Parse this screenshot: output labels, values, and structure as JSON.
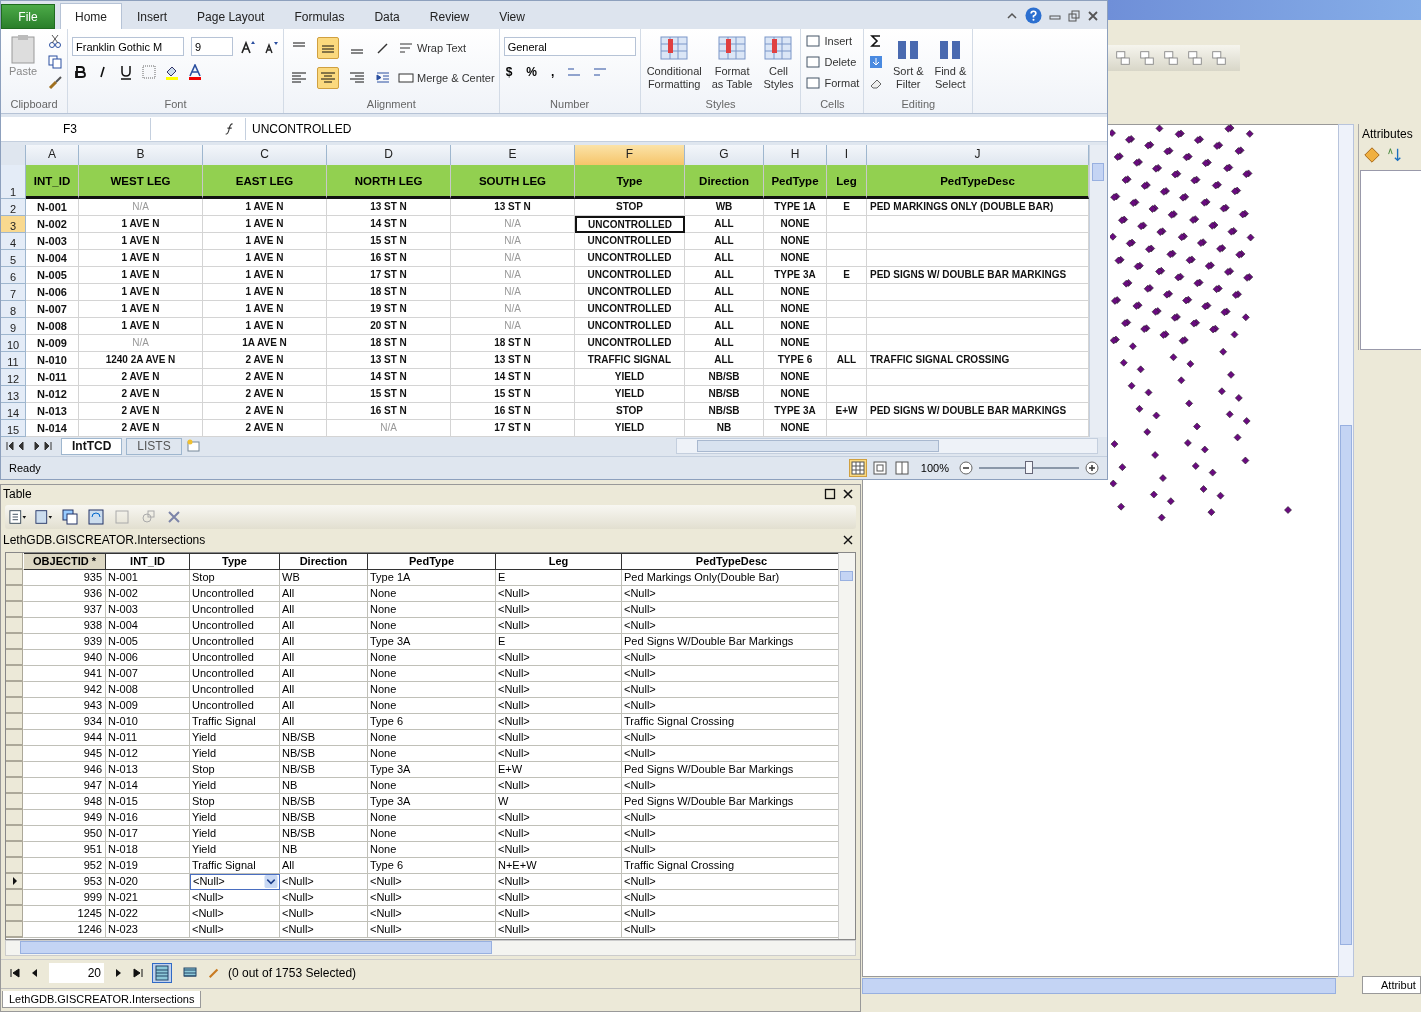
{
  "excel": {
    "file_tab": "File",
    "tabs": [
      {
        "label": "Home",
        "selected": true
      },
      {
        "label": "Insert",
        "selected": false
      },
      {
        "label": "Page Layout",
        "selected": false
      },
      {
        "label": "Formulas",
        "selected": false
      },
      {
        "label": "Data",
        "selected": false
      },
      {
        "label": "Review",
        "selected": false
      },
      {
        "label": "View",
        "selected": false
      }
    ],
    "ribbon": [
      {
        "kind": "clipboard",
        "label": "Clipboard",
        "paste": "Paste"
      },
      {
        "kind": "font",
        "label": "Font",
        "font_name": "Franklin Gothic M",
        "font_size": "9"
      },
      {
        "kind": "alignment",
        "label": "Alignment",
        "vertical_align": [
          {
            "selected": false
          },
          {
            "selected": true
          },
          {
            "selected": false
          }
        ],
        "horizontal_align": [
          {
            "selected": false
          },
          {
            "selected": true
          },
          {
            "selected": false
          }
        ],
        "wrap_text": "Wrap Text",
        "merge": "Merge & Center"
      },
      {
        "kind": "number",
        "label": "Number",
        "format": "General",
        "symbols": [
          "$",
          "%",
          ","
        ]
      },
      {
        "kind": "styles",
        "label": "Styles",
        "buttons": [
          {
            "lines": [
              "Conditional",
              "Formatting"
            ]
          },
          {
            "lines": [
              "Format",
              "as Table"
            ]
          },
          {
            "lines": [
              "Cell",
              "Styles"
            ]
          }
        ]
      },
      {
        "kind": "cells",
        "label": "Cells",
        "buttons": [
          "Insert",
          "Delete",
          "Format"
        ]
      },
      {
        "kind": "editing",
        "label": "Editing",
        "buttons": [
          {
            "lines": [
              "Sort &",
              "Filter"
            ]
          },
          {
            "lines": [
              "Find &",
              "Select"
            ]
          }
        ]
      }
    ],
    "name_box": "F3",
    "formula": "UNCONTROLLED",
    "columns": [
      {
        "letter": "A",
        "selected": false
      },
      {
        "letter": "B",
        "selected": false
      },
      {
        "letter": "C",
        "selected": false
      },
      {
        "letter": "D",
        "selected": false
      },
      {
        "letter": "E",
        "selected": false
      },
      {
        "letter": "F",
        "selected": true
      },
      {
        "letter": "G",
        "selected": false
      },
      {
        "letter": "H",
        "selected": false
      },
      {
        "letter": "I",
        "selected": false
      },
      {
        "letter": "J",
        "selected": false
      }
    ],
    "header_row": {
      "number": "1",
      "selected": false,
      "cells": [
        "INT_ID",
        "WEST LEG",
        "EAST LEG",
        "NORTH LEG",
        "SOUTH LEG",
        "Type",
        "Direction",
        "PedType",
        "Leg",
        "PedTypeDesc"
      ]
    },
    "rows": [
      {
        "number": "2",
        "selected": false,
        "cells": [
          "N-001",
          {
            "text": "N/A",
            "greyed": true
          },
          "1 AVE N",
          "13 ST N",
          "13 ST N",
          "STOP",
          "WB",
          "TYPE 1A",
          "E",
          "PED MARKINGS ONLY (DOUBLE BAR)"
        ]
      },
      {
        "number": "3",
        "selected": true,
        "cells": [
          "N-002",
          "1 AVE N",
          "1 AVE N",
          "14 ST N",
          {
            "text": "N/A",
            "greyed": true
          },
          {
            "text": "UNCONTROLLED",
            "active": true
          },
          "ALL",
          "NONE",
          null,
          null
        ]
      },
      {
        "number": "4",
        "selected": false,
        "cells": [
          "N-003",
          "1 AVE N",
          "1 AVE N",
          "15 ST N",
          {
            "text": "N/A",
            "greyed": true
          },
          "UNCONTROLLED",
          "ALL",
          "NONE",
          null,
          null
        ]
      },
      {
        "number": "5",
        "selected": false,
        "cells": [
          "N-004",
          "1 AVE N",
          "1 AVE N",
          "16 ST N",
          {
            "text": "N/A",
            "greyed": true
          },
          "UNCONTROLLED",
          "ALL",
          "NONE",
          null,
          null
        ]
      },
      {
        "number": "6",
        "selected": false,
        "cells": [
          "N-005",
          "1 AVE N",
          "1 AVE N",
          "17 ST N",
          {
            "text": "N/A",
            "greyed": true
          },
          "UNCONTROLLED",
          "ALL",
          "TYPE 3A",
          "E",
          "PED SIGNS W/ DOUBLE BAR MARKINGS"
        ]
      },
      {
        "number": "7",
        "selected": false,
        "cells": [
          "N-006",
          "1 AVE N",
          "1 AVE N",
          "18 ST N",
          {
            "text": "N/A",
            "greyed": true
          },
          "UNCONTROLLED",
          "ALL",
          "NONE",
          null,
          null
        ]
      },
      {
        "number": "8",
        "selected": false,
        "cells": [
          "N-007",
          "1 AVE N",
          "1 AVE N",
          "19 ST N",
          {
            "text": "N/A",
            "greyed": true
          },
          "UNCONTROLLED",
          "ALL",
          "NONE",
          null,
          null
        ]
      },
      {
        "number": "9",
        "selected": false,
        "cells": [
          "N-008",
          "1 AVE N",
          "1 AVE N",
          "20 ST N",
          {
            "text": "N/A",
            "greyed": true
          },
          "UNCONTROLLED",
          "ALL",
          "NONE",
          null,
          null
        ]
      },
      {
        "number": "10",
        "selected": false,
        "cells": [
          "N-009",
          {
            "text": "N/A",
            "greyed": true
          },
          "1A AVE N",
          "18 ST N",
          "18 ST N",
          "UNCONTROLLED",
          "ALL",
          "NONE",
          null,
          null
        ]
      },
      {
        "number": "11",
        "selected": false,
        "cells": [
          "N-010",
          "1240 2A AVE N",
          "2 AVE N",
          "13 ST N",
          "13 ST N",
          "TRAFFIC SIGNAL",
          "ALL",
          "TYPE 6",
          "ALL",
          "TRAFFIC SIGNAL CROSSING"
        ]
      },
      {
        "number": "12",
        "selected": false,
        "cells": [
          "N-011",
          "2 AVE N",
          "2 AVE N",
          "14 ST N",
          "14 ST N",
          "YIELD",
          "NB/SB",
          "NONE",
          null,
          null
        ]
      },
      {
        "number": "13",
        "selected": false,
        "cells": [
          "N-012",
          "2 AVE N",
          "2 AVE N",
          "15 ST N",
          "15 ST N",
          "YIELD",
          "NB/SB",
          "NONE",
          null,
          null
        ]
      },
      {
        "number": "14",
        "selected": false,
        "cells": [
          "N-013",
          "2 AVE N",
          "2 AVE N",
          "16 ST N",
          "16 ST N",
          "STOP",
          "NB/SB",
          "TYPE 3A",
          "E+W",
          "PED SIGNS W/ DOUBLE BAR MARKINGS"
        ]
      },
      {
        "number": "15",
        "selected": false,
        "cells": [
          "N-014",
          "2 AVE N",
          "2 AVE N",
          {
            "text": "N/A",
            "greyed": true
          },
          "17 ST N",
          "YIELD",
          "NB",
          "NONE",
          null,
          null
        ]
      }
    ],
    "sheet_tabs": [
      {
        "label": "IntTCD",
        "selected": true
      },
      {
        "label": "LISTS",
        "selected": false
      }
    ],
    "status": "Ready",
    "zoom": "100%",
    "zoom_slider": {
      "level": 0.5
    }
  },
  "table": {
    "title": "Table",
    "layer": "LethGDB.GISCREATOR.Intersections",
    "columns": [
      "OBJECTID *",
      "INT_ID",
      "Type",
      "Direction",
      "PedType",
      "Leg",
      "PedTypeDesc"
    ],
    "rows": [
      {
        "selected": false,
        "cells": [
          "935",
          "N-001",
          "Stop",
          "WB",
          "Type 1A",
          "E",
          "Ped Markings Only(Double Bar)"
        ]
      },
      {
        "selected": false,
        "cells": [
          "936",
          "N-002",
          "Uncontrolled",
          "All",
          "None",
          "<Null>",
          "<Null>"
        ]
      },
      {
        "selected": false,
        "cells": [
          "937",
          "N-003",
          "Uncontrolled",
          "All",
          "None",
          "<Null>",
          "<Null>"
        ]
      },
      {
        "selected": false,
        "cells": [
          "938",
          "N-004",
          "Uncontrolled",
          "All",
          "None",
          "<Null>",
          "<Null>"
        ]
      },
      {
        "selected": false,
        "cells": [
          "939",
          "N-005",
          "Uncontrolled",
          "All",
          "Type 3A",
          "E",
          "Ped Signs W/Double Bar Markings"
        ]
      },
      {
        "selected": false,
        "cells": [
          "940",
          "N-006",
          "Uncontrolled",
          "All",
          "None",
          "<Null>",
          "<Null>"
        ]
      },
      {
        "selected": false,
        "cells": [
          "941",
          "N-007",
          "Uncontrolled",
          "All",
          "None",
          "<Null>",
          "<Null>"
        ]
      },
      {
        "selected": false,
        "cells": [
          "942",
          "N-008",
          "Uncontrolled",
          "All",
          "None",
          "<Null>",
          "<Null>"
        ]
      },
      {
        "selected": false,
        "cells": [
          "943",
          "N-009",
          "Uncontrolled",
          "All",
          "None",
          "<Null>",
          "<Null>"
        ]
      },
      {
        "selected": false,
        "cells": [
          "934",
          "N-010",
          "Traffic Signal",
          "All",
          "Type 6",
          "<Null>",
          "Traffic Signal Crossing"
        ]
      },
      {
        "selected": false,
        "cells": [
          "944",
          "N-011",
          "Yield",
          "NB/SB",
          "None",
          "<Null>",
          "<Null>"
        ]
      },
      {
        "selected": false,
        "cells": [
          "945",
          "N-012",
          "Yield",
          "NB/SB",
          "None",
          "<Null>",
          "<Null>"
        ]
      },
      {
        "selected": false,
        "cells": [
          "946",
          "N-013",
          "Stop",
          "NB/SB",
          "Type 3A",
          "E+W",
          "Ped Signs W/Double Bar Markings"
        ]
      },
      {
        "selected": false,
        "cells": [
          "947",
          "N-014",
          "Yield",
          "NB",
          "None",
          "<Null>",
          "<Null>"
        ]
      },
      {
        "selected": false,
        "cells": [
          "948",
          "N-015",
          "Stop",
          "NB/SB",
          "Type 3A",
          "W",
          "Ped Signs W/Double Bar Markings"
        ]
      },
      {
        "selected": false,
        "cells": [
          "949",
          "N-016",
          "Yield",
          "NB/SB",
          "None",
          "<Null>",
          "<Null>"
        ]
      },
      {
        "selected": false,
        "cells": [
          "950",
          "N-017",
          "Yield",
          "NB/SB",
          "None",
          "<Null>",
          "<Null>"
        ]
      },
      {
        "selected": false,
        "cells": [
          "951",
          "N-018",
          "Yield",
          "NB",
          "None",
          "<Null>",
          "<Null>"
        ]
      },
      {
        "selected": false,
        "cells": [
          "952",
          "N-019",
          "Traffic Signal",
          "All",
          "Type 6",
          "N+E+W",
          "Traffic Signal Crossing"
        ]
      },
      {
        "selected": true,
        "cells": [
          "953",
          "N-020",
          {
            "text": "<Null>",
            "editing": true
          },
          "<Null>",
          "<Null>",
          "<Null>",
          "<Null>"
        ]
      },
      {
        "selected": false,
        "cells": [
          "999",
          "N-021",
          "<Null>",
          "<Null>",
          "<Null>",
          "<Null>",
          "<Null>"
        ]
      },
      {
        "selected": false,
        "cells": [
          "1245",
          "N-022",
          "<Null>",
          "<Null>",
          "<Null>",
          "<Null>",
          "<Null>"
        ]
      },
      {
        "selected": false,
        "cells": [
          "1246",
          "N-023",
          "<Null>",
          "<Null>",
          "<Null>",
          "<Null>",
          "<Null>"
        ]
      }
    ],
    "record": "20",
    "selection_status": "(0 out of 1753 Selected)",
    "view_buttons": [
      {
        "selected": true
      },
      {
        "selected": false
      }
    ],
    "bottom_tab": "LethGDB.GISCREATOR.Intersections"
  },
  "arcmap": {
    "attributes_title": "Attributes",
    "bottom_tab": "Attribut"
  }
}
